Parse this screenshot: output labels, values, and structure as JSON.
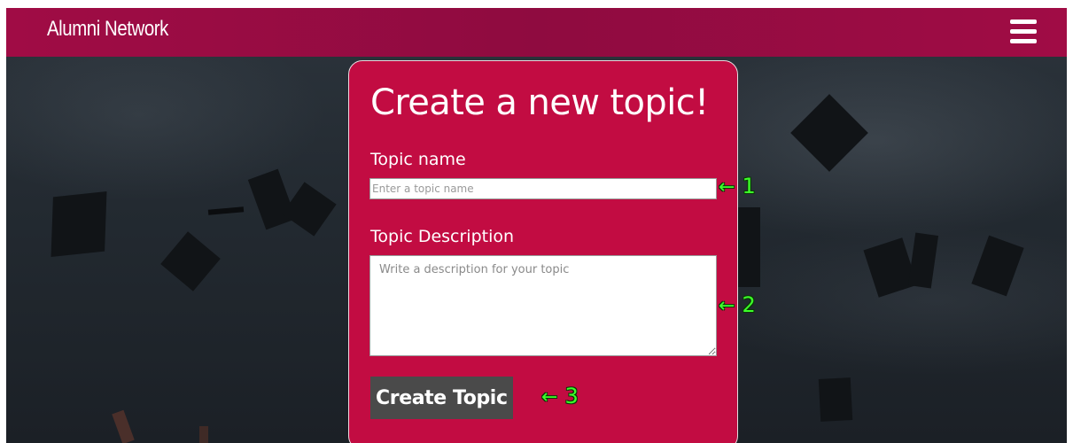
{
  "header": {
    "brand": "Alumni Network",
    "menu_icon": "hamburger-menu-icon"
  },
  "form": {
    "title": "Create a new topic!",
    "topic_name_label": "Topic name",
    "topic_name_placeholder": "Enter a topic name",
    "topic_name_value": "",
    "description_label": "Topic Description",
    "description_placeholder": "Write a description for your topic",
    "description_value": "",
    "submit_label": "Create Topic"
  },
  "annotations": [
    {
      "arrow": "←",
      "number": "1"
    },
    {
      "arrow": "←",
      "number": "2"
    },
    {
      "arrow": "←",
      "number": "3"
    }
  ],
  "colors": {
    "header_bg": "#9b0c44",
    "card_bg": "#c20c42",
    "button_bg": "#4a4a4a",
    "annotation": "#3dff2a"
  }
}
